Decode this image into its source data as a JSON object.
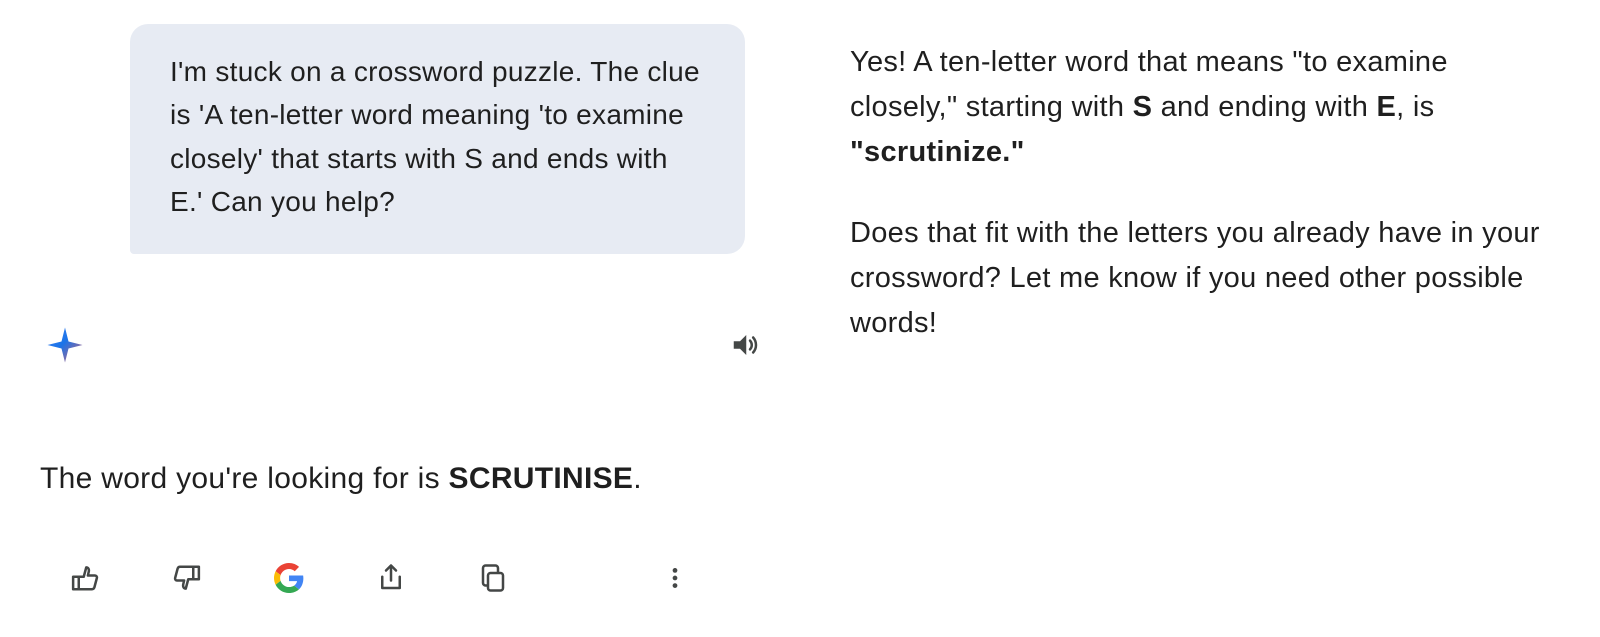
{
  "left": {
    "user_message": "I'm stuck on a crossword puzzle. The clue is 'A ten-letter word meaning 'to examine closely' that starts with S and ends with E.' Can you help?",
    "answer_prefix": "The word you're looking for is ",
    "answer_word": "SCRUTINISE",
    "answer_suffix": "."
  },
  "right": {
    "p1_a": "Yes! A ten-letter word that means \"to examine closely,\" starting with ",
    "p1_b": "S",
    "p1_c": " and ending with ",
    "p1_d": "E",
    "p1_e": ", is ",
    "p1_f": "\"scrutinize.\"",
    "p2": "Does that fit with the letters you already have in your crossword? Let me know if you need other possible words!"
  },
  "icons": {
    "sparkle": "sparkle-icon",
    "speaker": "speaker-icon",
    "thumbs_up": "thumbs-up-icon",
    "thumbs_down": "thumbs-down-icon",
    "google": "google-icon",
    "share": "share-icon",
    "copy": "copy-icon",
    "more": "more-icon"
  }
}
